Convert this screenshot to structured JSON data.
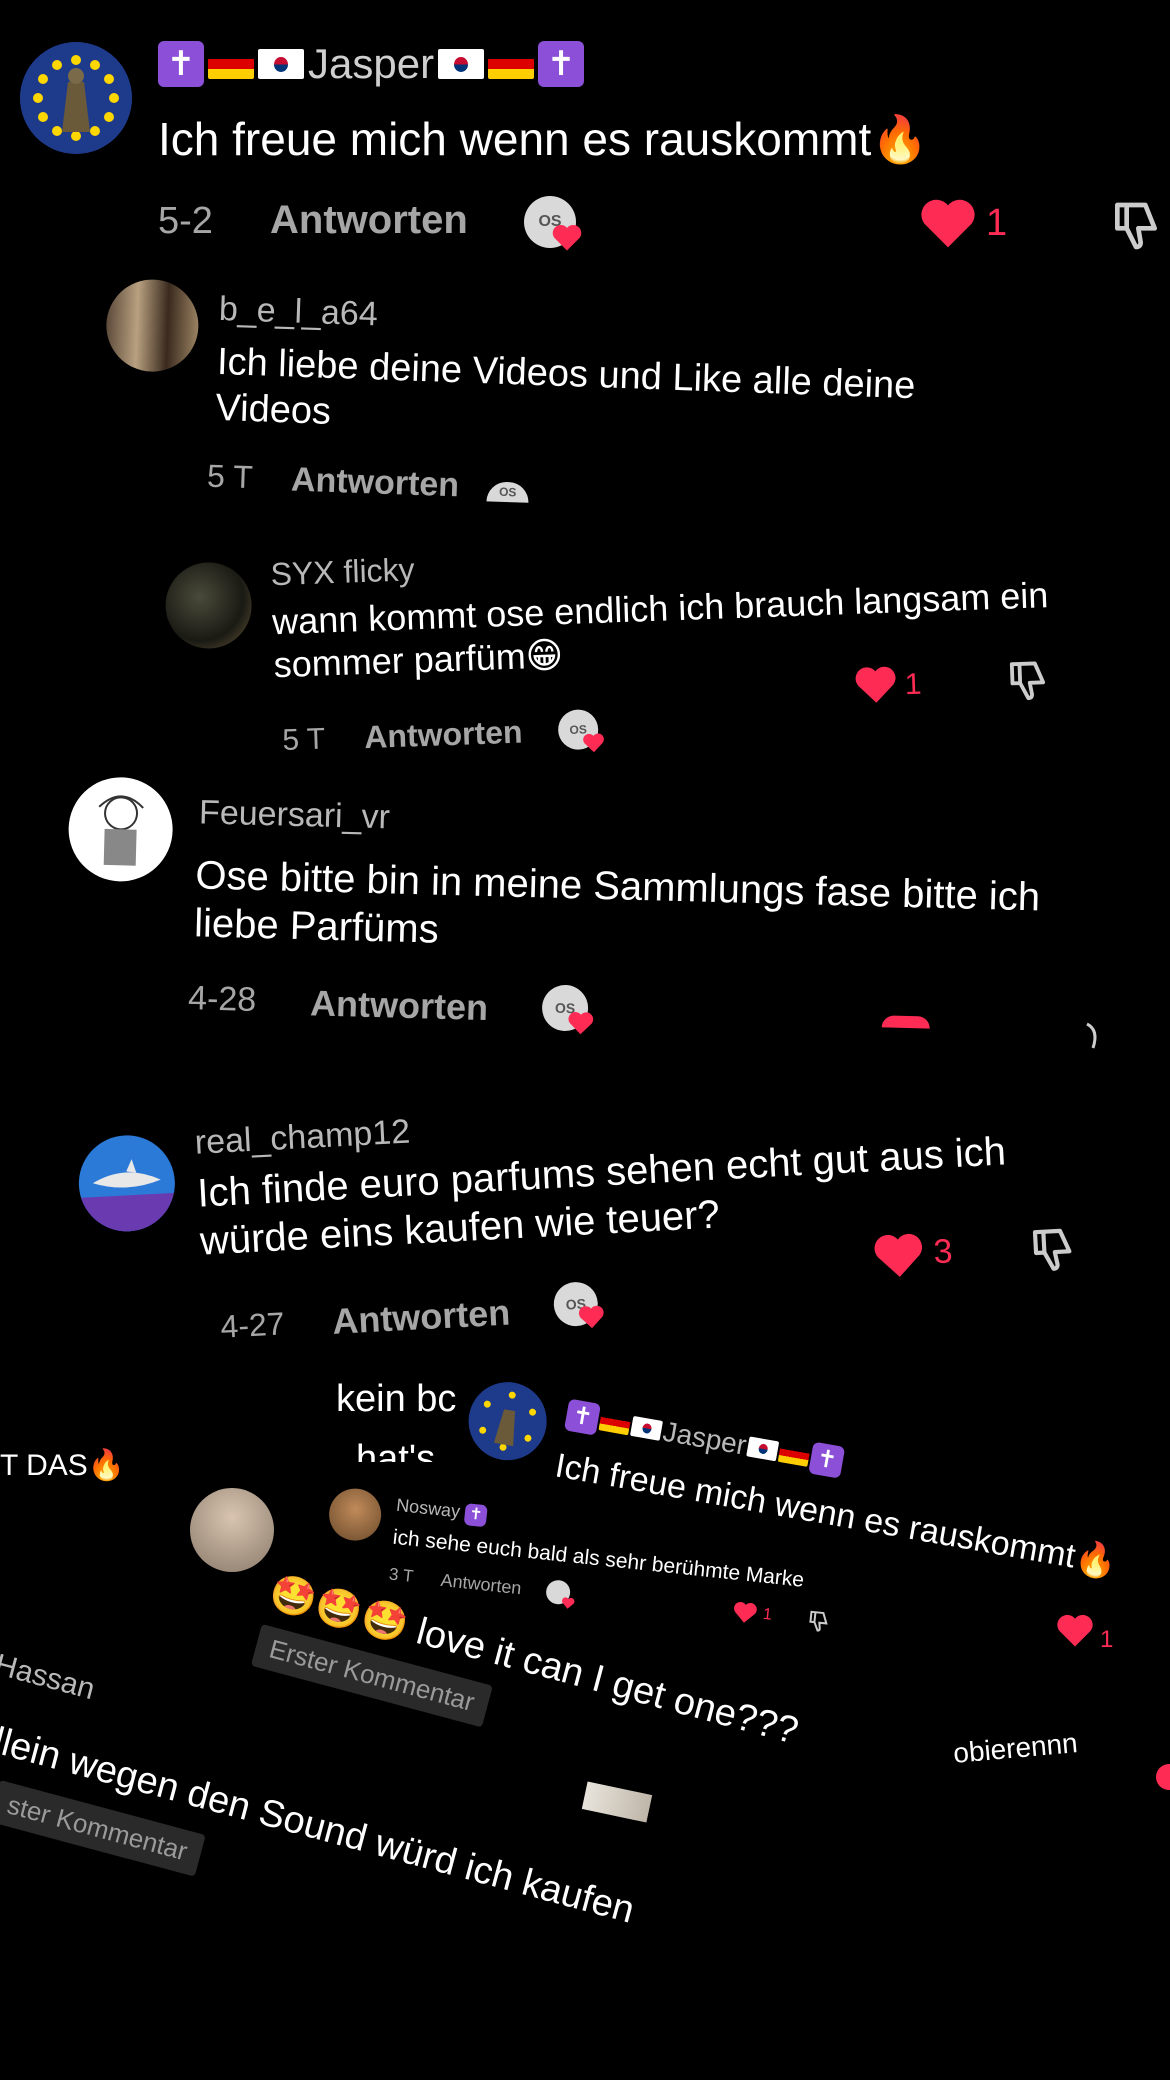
{
  "c1": {
    "name": "Jasper",
    "text": "Ich freue mich wenn es rauskommt",
    "date": "5-2",
    "reply": "Antworten",
    "likes": "1",
    "creator_like": "OS"
  },
  "c2": {
    "name": "b_e_l_a64",
    "text": "Ich liebe deine Videos und Like alle deine Videos",
    "date": "5 T",
    "reply": "Antworten",
    "creator_like": "OS"
  },
  "c3": {
    "name": "SYX flicky",
    "text": "wann kommt ose endlich ich brauch langsam ein sommer parfüm😁",
    "date": "5 T",
    "reply": "Antworten",
    "likes": "1",
    "creator_like": "OS"
  },
  "c4": {
    "name": "Feuersari_vr",
    "text": "Ose bitte bin in meine Sammlungs fase bitte ich liebe Parfüms",
    "date": "4-28",
    "reply": "Antworten",
    "creator_like": "OS"
  },
  "c5": {
    "name": "real_champ12",
    "text": "Ich finde euro parfums sehen echt gut aus ich würde eins kaufen wie teuer?",
    "date": "4-27",
    "reply": "Antworten",
    "likes": "3",
    "creator_like": "OS"
  },
  "collage": {
    "frag_kein": "kein bc",
    "frag_thats": "hat's",
    "frag_das": "T DAS",
    "jasper2_name": "Jasper",
    "jasper2_text": "Ich freue mich wenn es rauskommt",
    "jasper2_likes": "1",
    "nosway_name": "Nosway",
    "nosway_text": "ich sehe euch bald als sehr berühmte Marke",
    "nosway_date": "3 T",
    "nosway_reply": "Antworten",
    "nosway_likes": "1",
    "love_text": "love it can I get one???",
    "first_comment": "Erster Kommentar",
    "hassan": "Hassan",
    "sound_text": "llein wegen den Sound würd ich kaufen",
    "first_comment2": "ster Kommentar",
    "probieren": "obierennn"
  },
  "icons": {
    "heart_color": "#fe2c55",
    "cross": "✝"
  }
}
